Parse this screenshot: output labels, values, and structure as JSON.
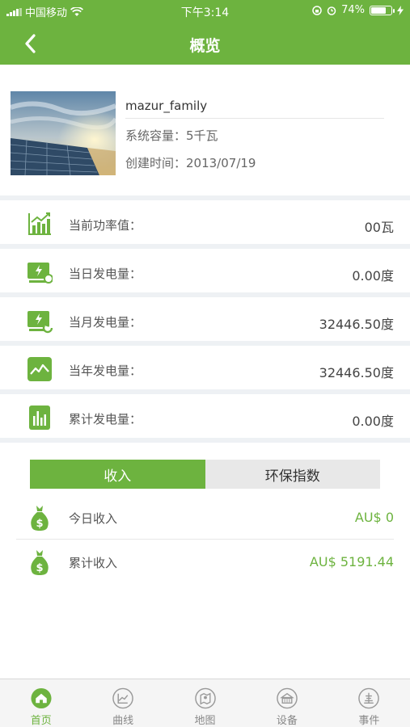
{
  "status": {
    "carrier": "中国移动",
    "time": "下午3:14",
    "battery": "74%"
  },
  "nav": {
    "title": "概览"
  },
  "profile": {
    "name": "mazur_family",
    "capacity": "系统容量：5千瓦",
    "created": "创建时间：2013/07/19"
  },
  "stats": [
    {
      "label": "当前功率值：",
      "value": "00瓦",
      "icon": "power-chart-icon"
    },
    {
      "label": "当日发电量：",
      "value": "0.00度",
      "icon": "day-energy-icon"
    },
    {
      "label": "当月发电量：",
      "value": "32446.50度",
      "icon": "month-energy-icon"
    },
    {
      "label": "当年发电量：",
      "value": "32446.50度",
      "icon": "year-energy-icon"
    },
    {
      "label": "累计发电量：",
      "value": "0.00度",
      "icon": "total-energy-icon"
    }
  ],
  "tabs": {
    "income": "收入",
    "eco": "环保指数"
  },
  "income": [
    {
      "label": "今日收入",
      "value": "AU$ 0"
    },
    {
      "label": "累计收入",
      "value": "AU$ 5191.44"
    }
  ],
  "tabbar": [
    {
      "label": "首页",
      "icon": "home-icon"
    },
    {
      "label": "曲线",
      "icon": "curve-icon"
    },
    {
      "label": "地图",
      "icon": "map-icon"
    },
    {
      "label": "设备",
      "icon": "device-icon"
    },
    {
      "label": "事件",
      "icon": "event-icon"
    }
  ],
  "colors": {
    "accent": "#6db33f",
    "separator": "#eef1f4"
  }
}
